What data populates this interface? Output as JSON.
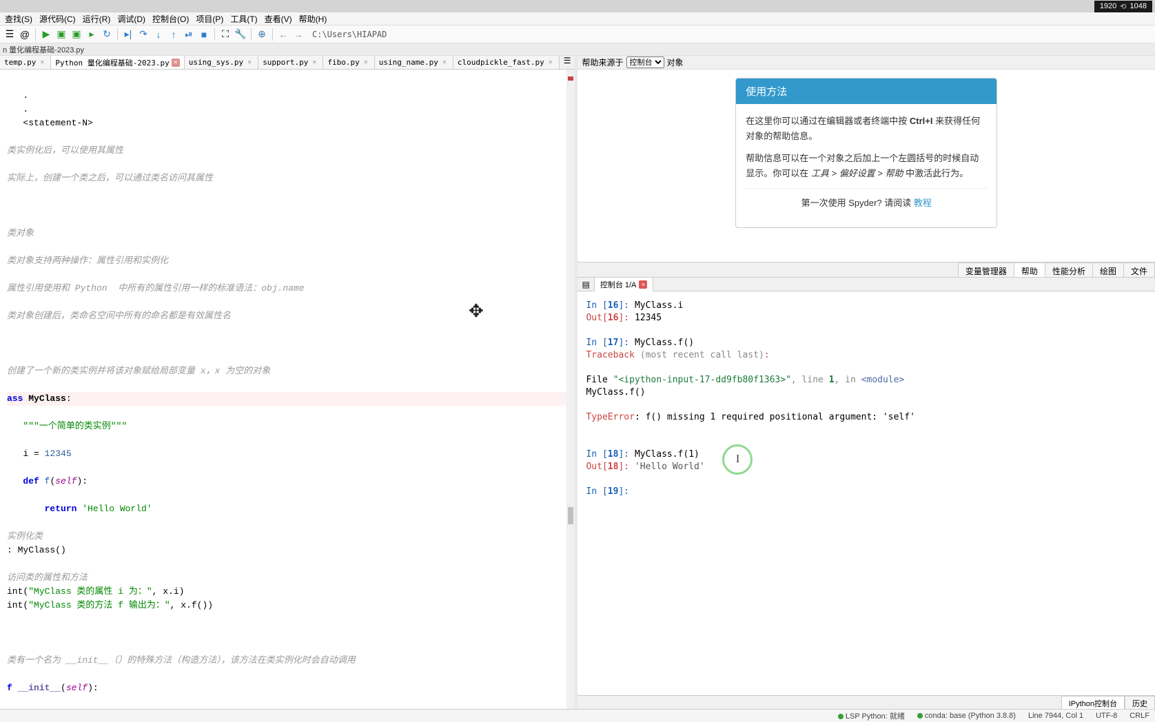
{
  "resolution": {
    "w": "1920",
    "h": "1048"
  },
  "menus": [
    "查找(S)",
    "源代码(C)",
    "运行(R)",
    "调试(D)",
    "控制台(O)",
    "项目(P)",
    "工具(T)",
    "查看(V)",
    "帮助(H)"
  ],
  "toolbar_path": "C:\\Users\\HIAPAD",
  "breadcrumb": "n 量化编程基础-2023.py",
  "editor_tabs": [
    {
      "label": "temp.py",
      "active": false,
      "mod": false
    },
    {
      "label": "Python 量化编程基础-2023.py",
      "active": true,
      "mod": true
    },
    {
      "label": "using_sys.py",
      "active": false,
      "mod": false
    },
    {
      "label": "support.py",
      "active": false,
      "mod": false
    },
    {
      "label": "fibo.py",
      "active": false,
      "mod": false
    },
    {
      "label": "using_name.py",
      "active": false,
      "mod": false
    },
    {
      "label": "cloudpickle_fast.py",
      "active": false,
      "mod": false
    }
  ],
  "code": {
    "l1": "   .",
    "l2": "   .",
    "l3": "   <statement-N>",
    "l4": "类实例化后，可以使用其属性",
    "l5": "实际上，创建一个类之后，可以通过类名访问其属性",
    "l6": "类对象",
    "l7": "类对象支持两种操作：属性引用和实例化",
    "l8": "属性引用使用和 Python  中所有的属性引用一样的标准语法：obj.name",
    "l9": "类对象创建后，类命名空间中所有的命名都是有效属性名",
    "l10": "创建了一个新的类实例并将该对象赋给局部变量 x，x 为空的对象",
    "kw_class": "ass ",
    "clsname": "MyClass",
    "docstr": "\"\"\"一个简单的类实例\"\"\"",
    "i_assign_a": "i = ",
    "i_assign_b": "12345",
    "kw_def": "def ",
    "fname": "f",
    "self": "self",
    "kw_return": "return ",
    "ret_str": "'Hello World'",
    "inst_cmt": "实例化类",
    "inst": ": MyClass()",
    "access_cmt": "访问类的属性和方法",
    "print1a": "int(",
    "print1s": "\"MyClass 类的属性 i 为：\"",
    "print1b": ", x.i)",
    "print2a": "int(",
    "print2s": "\"MyClass 类的方法 f 输出为：\"",
    "print2b": ", x.f())",
    "init_cmt": "类有一个名为 __init__（）的特殊方法（构造方法），该方法在类实例化时会自动调用",
    "init_def_a": "f ",
    "init_name": "__init__",
    "init_def_b": "(",
    "init_def_c": "):"
  },
  "help": {
    "source_label": "帮助来源于",
    "select": "控制台",
    "object_label": "对象",
    "title": "使用方法",
    "p1a": "在这里你可以通过在编辑器或者终端中按 ",
    "p1b": "Ctrl+I",
    "p1c": " 来获得任何对象的帮助信息。",
    "p2a": "帮助信息可以在一个对象之后加上一个左圆括号的时候自动显示。你可以在 ",
    "p2b": "工具 > 偏好设置 > 帮助",
    "p2c": " 中激活此行为。",
    "footer_a": "第一次使用 Spyder? 请阅读 ",
    "footer_link": "教程"
  },
  "side_tabs": [
    "变量管理器",
    "帮助",
    "性能分析",
    "绘图",
    "文件"
  ],
  "console_tab": "控制台 1/A",
  "console": {
    "in16": "MyClass.i",
    "out16": "12345",
    "in17": "MyClass.f()",
    "trace": "Traceback ",
    "trace2": "(most recent call last)",
    "file_lbl": "  File ",
    "file": "\"<ipython-input-17-dd9fb80f1363>\"",
    "line_lbl": ", line ",
    "line_n": "1",
    "in_lbl": ", in ",
    "mod": "<module>",
    "call": "    MyClass.f()",
    "err": "TypeError",
    "err_msg": ": f() missing 1 required positional argument: 'self'",
    "in18": "MyClass.f(1)",
    "out18": "'Hello World'",
    "in19": ""
  },
  "bottom_tabs": [
    "IPython控制台",
    "历史"
  ],
  "status": {
    "lsp": "LSP Python: 就绪",
    "conda": "conda: base (Python 3.8.8)",
    "pos": "Line 7944, Col 1",
    "enc": "UTF-8",
    "eol": "CRLF"
  }
}
